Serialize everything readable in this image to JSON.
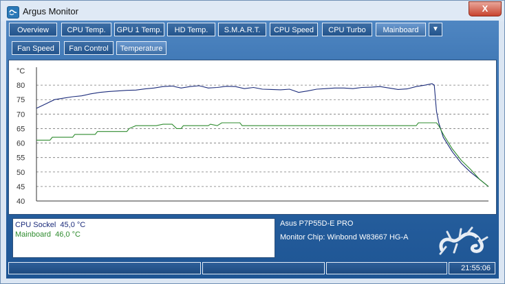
{
  "window": {
    "title": "Argus Monitor",
    "close_label": "X"
  },
  "tabs_row1": [
    {
      "label": "Overview"
    },
    {
      "label": "CPU Temp."
    },
    {
      "label": "GPU 1 Temp."
    },
    {
      "label": "HD Temp."
    },
    {
      "label": "S.M.A.R.T."
    },
    {
      "label": "CPU Speed"
    },
    {
      "label": "CPU Turbo"
    },
    {
      "label": "Mainboard"
    }
  ],
  "dropdown": {
    "icon": "chevron-down-icon",
    "glyph": "▼"
  },
  "tabs_row2": [
    {
      "label": "Fan Speed"
    },
    {
      "label": "Fan Control"
    },
    {
      "label": "Temperature"
    }
  ],
  "active_tab_row1": "Mainboard",
  "active_tab_row2": "Temperature",
  "chart_data": {
    "type": "line",
    "ylabel": "°C",
    "ylim": [
      40,
      85
    ],
    "yticks": [
      80,
      75,
      70,
      65,
      60,
      55,
      50,
      45,
      40
    ],
    "grid": true,
    "series": [
      {
        "name": "CPU Sockel",
        "color": "#1a2a7a",
        "points": [
          [
            0,
            72
          ],
          [
            2,
            73.5
          ],
          [
            4,
            75
          ],
          [
            6,
            75.5
          ],
          [
            8,
            76
          ],
          [
            10,
            76.3
          ],
          [
            12,
            77
          ],
          [
            14,
            77.5
          ],
          [
            16,
            77.8
          ],
          [
            18,
            78
          ],
          [
            20,
            78.2
          ],
          [
            22,
            78.3
          ],
          [
            24,
            78.7
          ],
          [
            26,
            79
          ],
          [
            28,
            79.5
          ],
          [
            30,
            79.7
          ],
          [
            32,
            79
          ],
          [
            34,
            79.5
          ],
          [
            36,
            79.8
          ],
          [
            38,
            79
          ],
          [
            40,
            79.2
          ],
          [
            42,
            79.6
          ],
          [
            44,
            79.5
          ],
          [
            46,
            78.8
          ],
          [
            48,
            79.2
          ],
          [
            50,
            78.6
          ],
          [
            52,
            78.5
          ],
          [
            54,
            78.4
          ],
          [
            56,
            78.6
          ],
          [
            58,
            77.5
          ],
          [
            60,
            78
          ],
          [
            62,
            78.6
          ],
          [
            64,
            78.8
          ],
          [
            66,
            79
          ],
          [
            68,
            79
          ],
          [
            70,
            78.8
          ],
          [
            72,
            79.2
          ],
          [
            74,
            79.3
          ],
          [
            76,
            79.5
          ],
          [
            78,
            79
          ],
          [
            80,
            78.5
          ],
          [
            82,
            78.7
          ],
          [
            84,
            79.5
          ],
          [
            86,
            80
          ],
          [
            87.5,
            80.5
          ],
          [
            88,
            80
          ],
          [
            88.5,
            71
          ],
          [
            89,
            67
          ],
          [
            90,
            62
          ],
          [
            92,
            57
          ],
          [
            94,
            53
          ],
          [
            96,
            50
          ],
          [
            98,
            47.5
          ],
          [
            100,
            45
          ]
        ]
      },
      {
        "name": "Mainboard",
        "color": "#2e8b2e",
        "points": [
          [
            0,
            61
          ],
          [
            3,
            61
          ],
          [
            3.5,
            62
          ],
          [
            8,
            62
          ],
          [
            8.5,
            63
          ],
          [
            13,
            63
          ],
          [
            13.5,
            64
          ],
          [
            20,
            64
          ],
          [
            20.5,
            65
          ],
          [
            22,
            66
          ],
          [
            26,
            66
          ],
          [
            26.5,
            66
          ],
          [
            28,
            66.5
          ],
          [
            30,
            66.5
          ],
          [
            31,
            65
          ],
          [
            32,
            65
          ],
          [
            32.5,
            66
          ],
          [
            38,
            66
          ],
          [
            38.5,
            66.5
          ],
          [
            40,
            66
          ],
          [
            41,
            67
          ],
          [
            45,
            67
          ],
          [
            45.5,
            66
          ],
          [
            55,
            66
          ],
          [
            55.5,
            66
          ],
          [
            60,
            66
          ],
          [
            70,
            66
          ],
          [
            78,
            66
          ],
          [
            84,
            66
          ],
          [
            84.5,
            67
          ],
          [
            88.5,
            67
          ],
          [
            89,
            66
          ],
          [
            90,
            63
          ],
          [
            92,
            58
          ],
          [
            94,
            54
          ],
          [
            96,
            51
          ],
          [
            98,
            47.5
          ],
          [
            100,
            45
          ]
        ]
      }
    ]
  },
  "readout": {
    "cpu_label": "CPU Sockel",
    "cpu_value": "45,0 °C",
    "mb_label": "Mainboard",
    "mb_value": "46,0 °C",
    "cpu_color": "#1a2a7a",
    "mb_color": "#2e8b2e"
  },
  "info": {
    "board": "Asus P7P55D-E PRO",
    "chip": "Monitor Chip: Winbond W83667 HG-A"
  },
  "logo": {
    "icon": "gecko-logo-icon"
  },
  "status": {
    "time": "21:55:06"
  }
}
